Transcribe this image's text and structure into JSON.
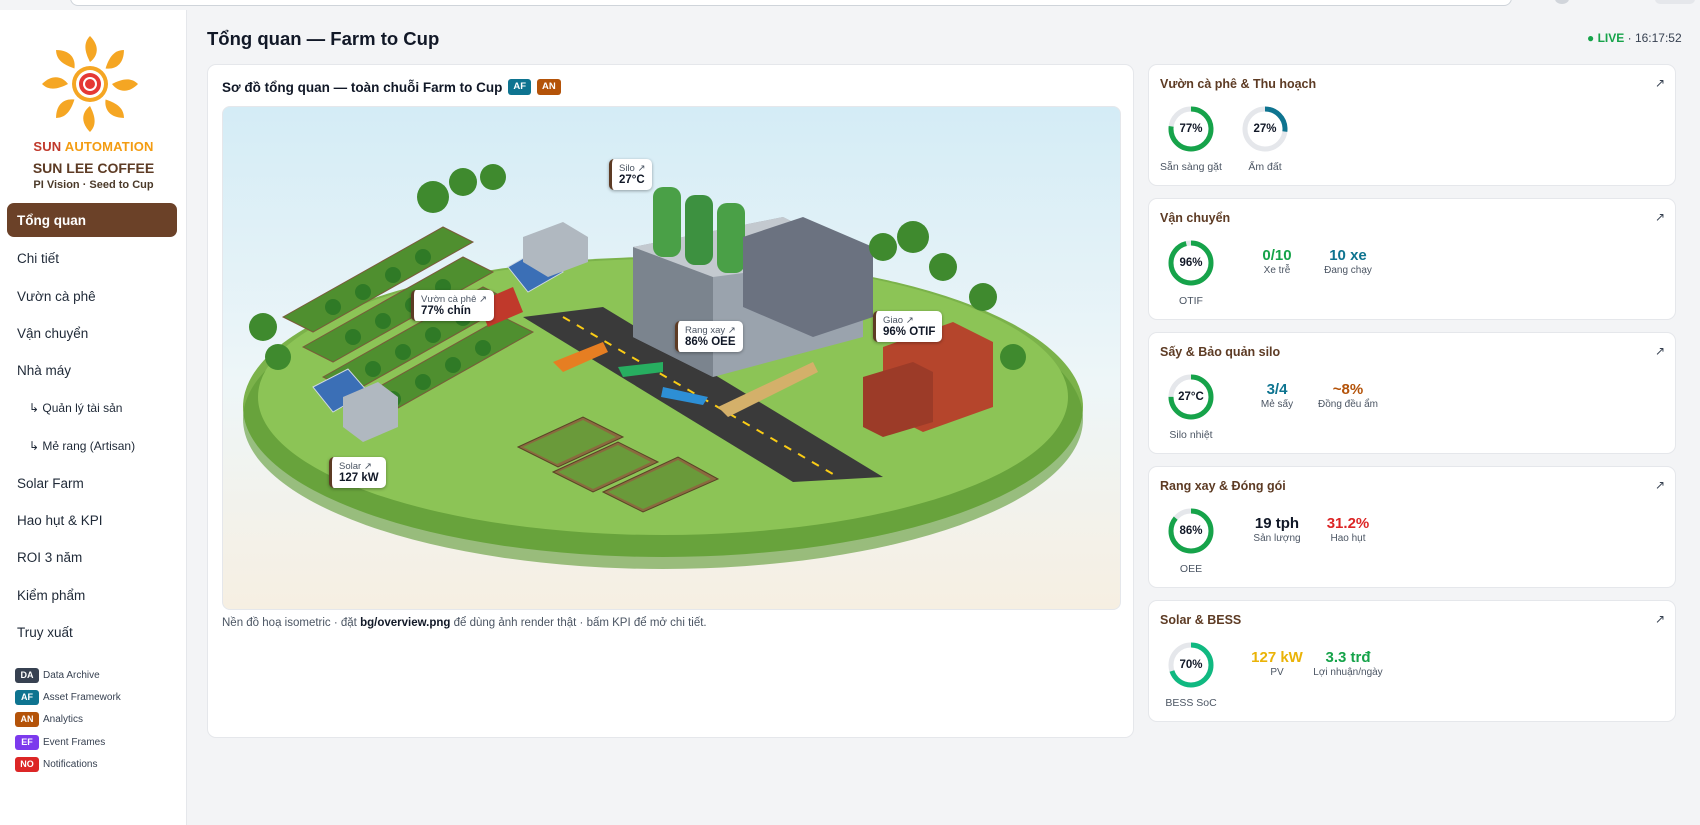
{
  "header": {
    "title": "Tổng quan — Farm to Cup",
    "live_dot": "●",
    "live_label": "LIVE",
    "time": "· 16:17:52"
  },
  "brand": {
    "line1_a": "SUN",
    "line1_b": "AUTOMATION",
    "line2": "SUN LEE COFFEE",
    "line3": "PI Vision · Seed to Cup"
  },
  "nav": [
    {
      "label": "Tổng quan",
      "active": true
    },
    {
      "label": "Chi tiết"
    },
    {
      "label": "Vườn cà phê"
    },
    {
      "label": "Vận chuyển"
    },
    {
      "label": "Nhà máy"
    },
    {
      "label": "↳ Quản lý tài sản"
    },
    {
      "label": "↳ Mẻ rang (Artisan)"
    },
    {
      "label": "Solar Farm"
    },
    {
      "label": "Hao hụt & KPI"
    },
    {
      "label": "ROI 3 năm"
    },
    {
      "label": "Kiểm phẩm"
    },
    {
      "label": "Truy xuất"
    }
  ],
  "legend": [
    {
      "code": "DA",
      "label": "Data Archive",
      "color": "#374151"
    },
    {
      "code": "AF",
      "label": "Asset Framework",
      "color": "#0e7490"
    },
    {
      "code": "AN",
      "label": "Analytics",
      "color": "#b45309"
    },
    {
      "code": "EF",
      "label": "Event Frames",
      "color": "#7c3aed"
    },
    {
      "code": "NO",
      "label": "Notifications",
      "color": "#dc2626"
    }
  ],
  "main": {
    "title": "Sơ đồ tổng quan — toàn chuỗi Farm to Cup",
    "badges": [
      {
        "code": "AF",
        "color": "#0e7490"
      },
      {
        "code": "AN",
        "color": "#b45309"
      }
    ],
    "callouts": {
      "silo": {
        "label": "Silo ↗",
        "value": "27°C"
      },
      "farm": {
        "label": "Vườn cà phê ↗",
        "value": "77% chín"
      },
      "roast": {
        "label": "Rang xay ↗",
        "value": "86% OEE"
      },
      "deliver": {
        "label": "Giao ↗",
        "value": "96% OTIF"
      },
      "solar": {
        "label": "Solar ↗",
        "value": "127 kW"
      }
    },
    "caption_a": "Nền đồ hoạ isometric · đặt ",
    "caption_file": "bg/overview.png",
    "caption_b": " để dùng ảnh render thật · bấm KPI để mở chi tiết."
  },
  "cards": {
    "link_icon": "↗",
    "farm": {
      "title": "Vườn cà phê & Thu hoạch",
      "g1": {
        "value": "77%",
        "pct": 77,
        "label": "Sẵn sàng gặt",
        "color": "#16a34a"
      },
      "g2": {
        "value": "27%",
        "pct": 27,
        "label": "Ẩm đất",
        "color": "#0e7490"
      }
    },
    "transport": {
      "title": "Vận chuyển",
      "g1": {
        "value": "96%",
        "pct": 96,
        "label": "OTIF",
        "color": "#16a34a"
      },
      "s1": {
        "value": "0/10",
        "label": "Xe trễ",
        "color": "#16a34a"
      },
      "s2": {
        "value": "10 xe",
        "label": "Đang chạy",
        "color": "#0e7490"
      }
    },
    "silo": {
      "title": "Sấy & Bảo quản silo",
      "g1": {
        "value": "27°C",
        "pct": 75,
        "label": "Silo nhiệt",
        "color": "#16a34a"
      },
      "s1": {
        "value": "3/4",
        "label": "Mẻ sấy",
        "color": "#0e7490"
      },
      "s2": {
        "value": "~8%",
        "label": "Đồng đều ẩm",
        "color": "#b45309"
      }
    },
    "roast": {
      "title": "Rang xay & Đóng gói",
      "g1": {
        "value": "86%",
        "pct": 86,
        "label": "OEE",
        "color": "#16a34a"
      },
      "s1": {
        "value": "19 tph",
        "label": "Sản lượng",
        "color": "#111827"
      },
      "s2": {
        "value": "31.2%",
        "label": "Hao hụt",
        "color": "#dc2626"
      }
    },
    "solar": {
      "title": "Solar & BESS",
      "g1": {
        "value": "70%",
        "pct": 70,
        "label": "BESS SoC",
        "color": "#10b981"
      },
      "s1": {
        "value": "127 kW",
        "label": "PV",
        "color": "#eab308"
      },
      "s2": {
        "value": "3.3 trđ",
        "label": "Lợi nhuận/ngày",
        "color": "#16a34a"
      }
    }
  }
}
